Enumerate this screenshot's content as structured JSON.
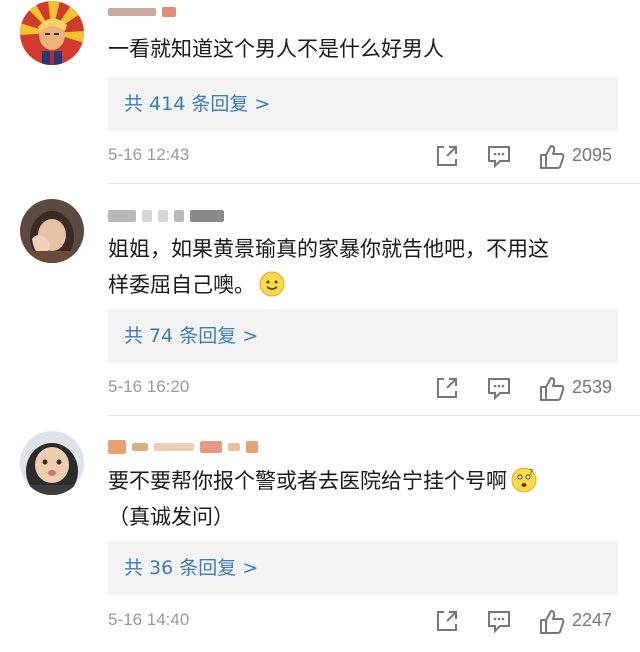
{
  "comments": [
    {
      "text_lines": [
        "一看就知道这个男人不是什么好男人"
      ],
      "replies": "共 414 条回复 >",
      "time": "5-16 12:43",
      "likes": "2095",
      "avatar": "cartoon-portrait"
    },
    {
      "text_lines": [
        "姐姐，如果黄景瑜真的家暴你就告他吧，不用这",
        "样委屈自己噢。"
      ],
      "emoji": "smile-emoji",
      "replies": "共 74 条回复 >",
      "time": "5-16 16:20",
      "likes": "2539",
      "avatar": "child-photo"
    },
    {
      "text_lines": [
        "要不要帮你报个警或者去医院给宁挂个号啊",
        "（真诚发问）"
      ],
      "emoji": "confused-emoji",
      "replies": "共 36 条回复 >",
      "time": "5-16 14:40",
      "likes": "2247",
      "avatar": "baby-photo"
    }
  ],
  "icons": {
    "share": "share-icon",
    "comment": "comment-icon",
    "like": "thumbs-up-icon"
  },
  "colors": {
    "reply_link": "#3b7bbf",
    "reply_bg": "#f3f3f3",
    "meta_text": "#999999"
  }
}
